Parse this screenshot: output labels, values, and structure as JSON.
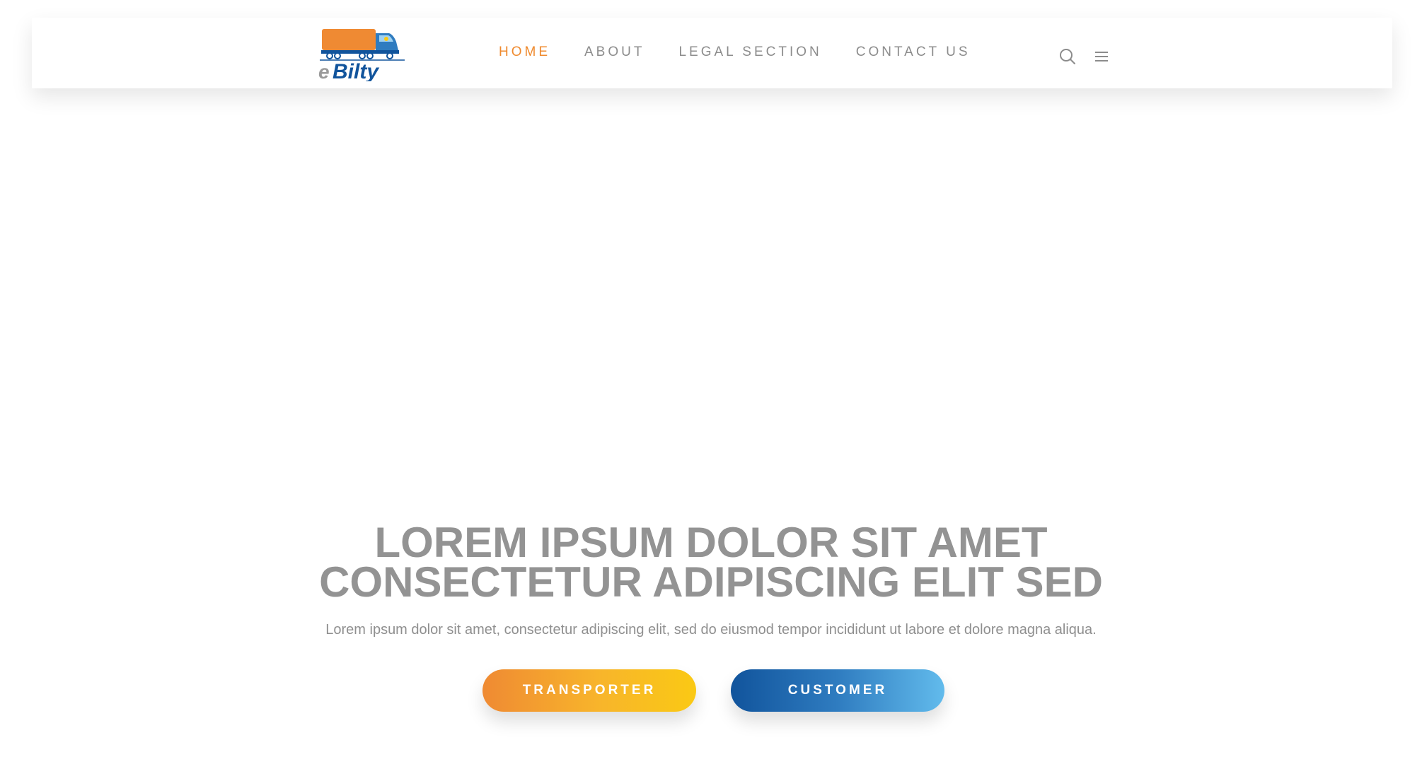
{
  "colors": {
    "accent_orange": "#ef8a2e",
    "nav_text": "#8c8c8c",
    "heading": "#939393",
    "brand_blue": "#11549c",
    "gradient_transporter": [
      "#ef8a33",
      "#fac914"
    ],
    "gradient_customer": [
      "#11549c",
      "#62bbec"
    ]
  },
  "logo": {
    "text_e": "e",
    "text_bilty": "Bilty",
    "icon": "truck-icon"
  },
  "nav": {
    "items": [
      {
        "label": "HOME",
        "active": true
      },
      {
        "label": "ABOUT",
        "active": false
      },
      {
        "label": "LEGAL SECTION",
        "active": false
      },
      {
        "label": "CONTACT US",
        "active": false
      }
    ],
    "search_icon": "search-icon",
    "menu_icon": "hamburger-menu-icon"
  },
  "hero": {
    "title_line1": "LOREM IPSUM DOLOR SIT AMET",
    "title_line2": "CONSECTETUR ADIPISCING ELIT SED",
    "subtitle": "Lorem ipsum dolor sit amet, consectetur adipiscing elit, sed do eiusmod tempor incididunt ut labore et dolore magna aliqua.",
    "buttons": {
      "transporter": "TRANSPORTER",
      "customer": "CUSTOMER"
    }
  }
}
